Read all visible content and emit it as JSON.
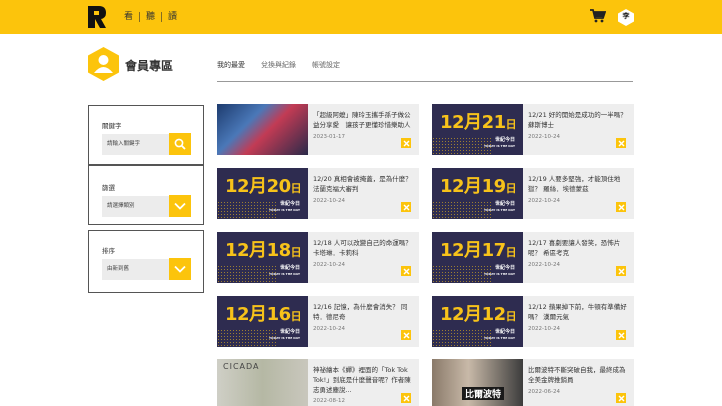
{
  "header": {
    "nav": [
      "看",
      "聽",
      "讀"
    ],
    "user_initial": "李"
  },
  "member": {
    "title": "會員專區",
    "tabs": [
      "我的最愛",
      "兌換與紀錄",
      "帳號設定"
    ]
  },
  "sidebar": {
    "keyword": {
      "label": "關鍵字",
      "placeholder": "請輸入關鍵字"
    },
    "filter": {
      "label": "篩選",
      "value": "請選擇類別"
    },
    "sort": {
      "label": "排序",
      "value": "由新到舊"
    }
  },
  "cards": [
    {
      "thumb_type": "photo",
      "title": "「超級阿嬤」陳玲玉攜手孫子做公益分享愛　讓孩子更懂珍惜樂助人",
      "date": "2023-01-17"
    },
    {
      "thumb_type": "daily",
      "thumb_month": "12月",
      "thumb_day": "21",
      "thumb_suffix": "日",
      "title": "12/21 好的開始是成功的一半嗎？ 蘇斯博士",
      "date": "2022-10-24"
    },
    {
      "thumb_type": "daily",
      "thumb_month": "12月",
      "thumb_day": "20",
      "thumb_suffix": "日",
      "title": "12/20 真相會被掩蓋，是為什麼？ 法蘭克福大審判",
      "date": "2022-10-24"
    },
    {
      "thumb_type": "daily",
      "thumb_month": "12月",
      "thumb_day": "19",
      "thumb_suffix": "日",
      "title": "12/19 人要多堅強，才能頂住地獄？ 羅絲．埃德蒙茲",
      "date": "2022-10-24"
    },
    {
      "thumb_type": "daily",
      "thumb_month": "12月",
      "thumb_day": "18",
      "thumb_suffix": "日",
      "title": "12/18 人可以改變自己的命運嗎？ 卡塔琳．卡莉科",
      "date": "2022-10-24"
    },
    {
      "thumb_type": "daily",
      "thumb_month": "12月",
      "thumb_day": "17",
      "thumb_suffix": "日",
      "title": "12/17 喜劇要讓人發笑，恐怖片呢？ 希區考克",
      "date": "2022-10-24"
    },
    {
      "thumb_type": "daily",
      "thumb_month": "12月",
      "thumb_day": "16",
      "thumb_suffix": "日",
      "title": "12/16 記憶，為什麼會消失？ 同特．德尼奇",
      "date": "2022-10-24"
    },
    {
      "thumb_type": "daily",
      "thumb_month": "12月",
      "thumb_day": "12",
      "thumb_suffix": "日",
      "title": "12/12 蘋果掉下前，牛頓有準備好嗎？ 漢爾元氣",
      "date": "2022-10-24"
    },
    {
      "thumb_type": "photo2",
      "thumb_text": "CICADA",
      "title": "神祕繪本《蟬》裡面的「Tok Tok Tok!」到底是什麼聲音呢？作者陳志勇述塵說...",
      "date": "2022-08-12"
    },
    {
      "thumb_type": "photo3",
      "thumb_text": "比爾波特",
      "title": "比爾波特不斷突破自我，最終成為全美金牌推銷員",
      "date": "2022-06-24"
    }
  ],
  "daily_brand": "世紀今日",
  "daily_brand_en": "TODAY IS THE DAY",
  "colors": {
    "brand_yellow": "#fcc40c",
    "daily_purple": "#2e2c50"
  }
}
